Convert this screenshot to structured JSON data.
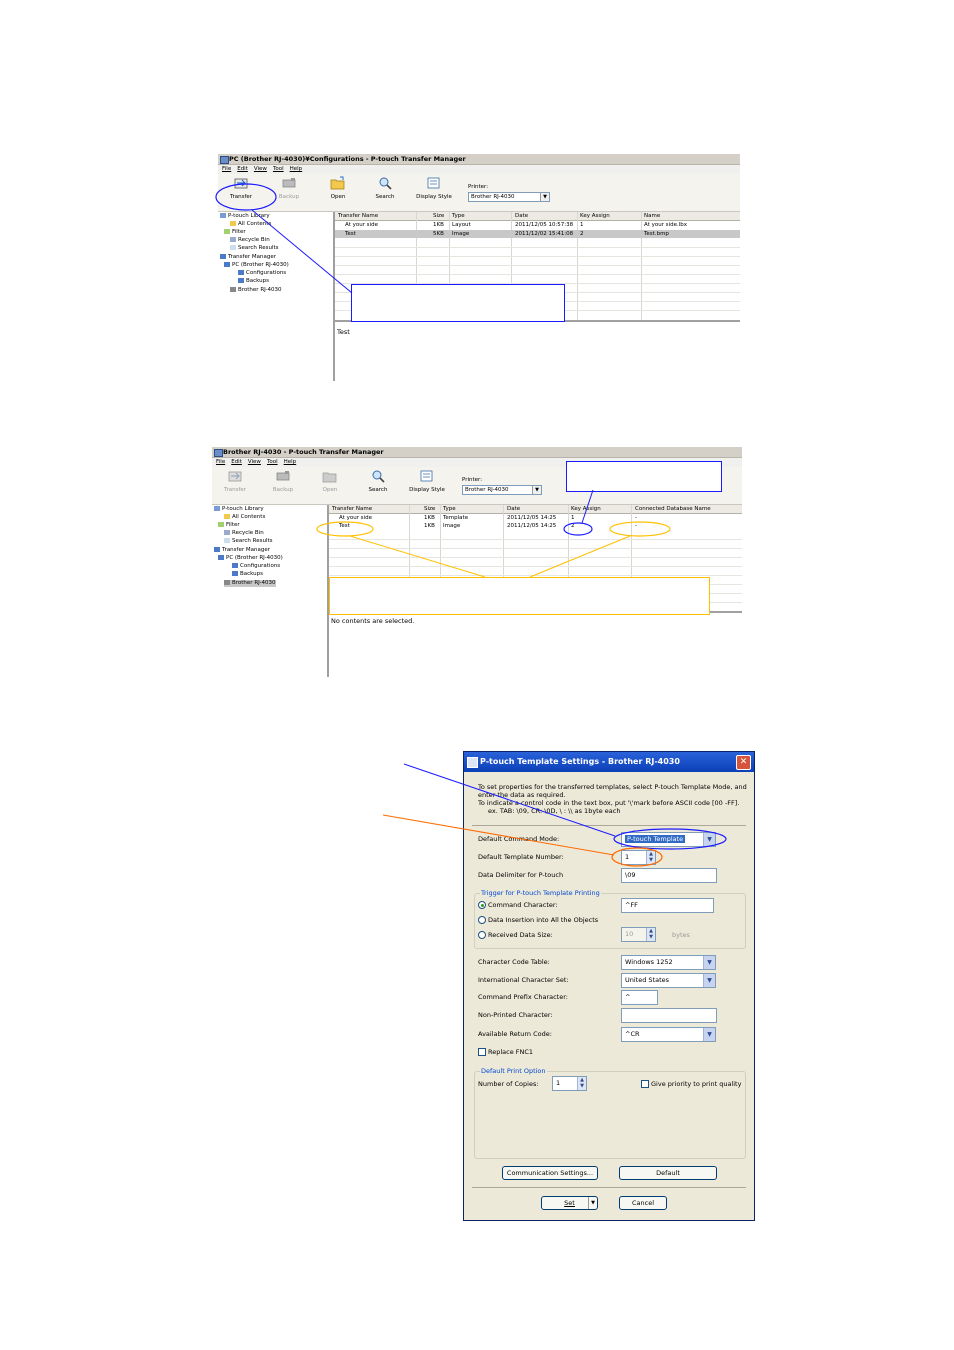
{
  "window1": {
    "title": "PC (Brother RJ-4030)¥Configurations - P-touch Transfer Manager",
    "menu": [
      "File",
      "Edit",
      "View",
      "Tool",
      "Help"
    ],
    "toolbar": {
      "transfer": "Transfer",
      "backup": "Backup",
      "open": "Open",
      "search": "Search",
      "display_style": "Display Style"
    },
    "printer_label": "Printer:",
    "printer_value": "Brother RJ-4030",
    "tree": [
      "P-touch Library",
      "All Contents",
      "Filter",
      "Recycle Bin",
      "Search Results",
      "Transfer Manager",
      "PC (Brother RJ-4030)",
      "Configurations",
      "Backups",
      "Brother RJ-4030"
    ],
    "columns": [
      "Transfer Name",
      "Size",
      "Type",
      "Date",
      "Key Assign",
      "Name"
    ],
    "rows": [
      {
        "name": "At your side",
        "size": "1KB",
        "type": "Layout",
        "date": "2011/12/05 10:57:38",
        "key": "1",
        "file": "At your side.lbx"
      },
      {
        "name": "Test",
        "size": "5KB",
        "type": "Image",
        "date": "2011/12/02 15:41:08",
        "key": "2",
        "file": "Test.bmp"
      }
    ],
    "preview_text": "Test"
  },
  "window2": {
    "title": "Brother RJ-4030 - P-touch Transfer Manager",
    "menu": [
      "File",
      "Edit",
      "View",
      "Tool",
      "Help"
    ],
    "toolbar": {
      "transfer": "Transfer",
      "backup": "Backup",
      "open": "Open",
      "search": "Search",
      "display_style": "Display Style"
    },
    "printer_label": "Printer:",
    "printer_value": "Brother RJ-4030",
    "tree": [
      "P-touch Library",
      "All Contents",
      "Filter",
      "Recycle Bin",
      "Search Results",
      "Transfer Manager",
      "PC (Brother RJ-4030)",
      "Configurations",
      "Backups",
      "Brother RJ-4030"
    ],
    "columns": [
      "Transfer Name",
      "Size",
      "Type",
      "Date",
      "Key Assign",
      "Connected Database Name"
    ],
    "rows": [
      {
        "name": "At your side",
        "size": "1KB",
        "type": "Template",
        "date": "2011/12/05 14:25",
        "key": "1",
        "db": "-"
      },
      {
        "name": "Test",
        "size": "1KB",
        "type": "Image",
        "date": "2011/12/05 14:25",
        "key": "2",
        "db": "-"
      }
    ],
    "preview_text": "No contents are selected."
  },
  "dialog": {
    "title": "P-touch Template Settings - Brother RJ-4030",
    "intro1": "To set properties for the transferred templates, select P-touch Template Mode, and",
    "intro2": "enter the data as required.",
    "intro3": "To indicate a control code in the text box, put '\\'mark before ASCII code [00 -FF].",
    "intro4": "ex. TAB: \\09, CR: \\0D, \\ : \\\\ as 1byte each",
    "cmd_mode_label": "Default Command Mode:",
    "cmd_mode_value": "P-touch Template",
    "tpl_num_label": "Default Template Number:",
    "tpl_num_value": "1",
    "delim_label": "Data Delimiter for P-touch",
    "delim_value": "\\09",
    "trigger_group": "Trigger for P-touch Template Printing",
    "trig_cmd_label": "Command Character:",
    "trig_cmd_value": "^FF",
    "trig_insert_label": "Data Insertion into All the Objects",
    "trig_size_label": "Received Data Size:",
    "trig_size_value": "10",
    "trig_size_unit": "bytes",
    "charset_label": "Character Code Table:",
    "charset_value": "Windows 1252",
    "intl_label": "International Character Set:",
    "intl_value": "United States",
    "prefix_label": "Command Prefix Character:",
    "prefix_value": "^",
    "nonprint_label": "Non-Printed Character:",
    "nonprint_value": "",
    "return_label": "Available Return Code:",
    "return_value": "^CR",
    "replace_label": "Replace FNC1",
    "print_group": "Default Print Option",
    "copies_label": "Number of Copies:",
    "copies_value": "1",
    "priority_label": "Give priority to print quality",
    "comm_btn": "Communication Settings...",
    "default_btn": "Default",
    "set_btn": "Set",
    "cancel_btn": "Cancel"
  },
  "colors": {
    "annotation_blue": "#1a1aff",
    "annotation_orange": "#ff6a00",
    "annotation_yellow": "#ffc000",
    "xp_title": "#0b3fb8"
  }
}
